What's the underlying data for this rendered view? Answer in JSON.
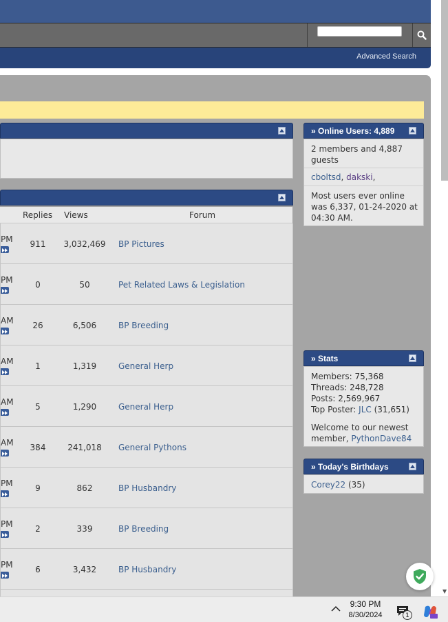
{
  "header": {
    "search": {
      "placeholder": "",
      "value": ""
    },
    "advanced_search_label": "Advanced Search"
  },
  "thread_table": {
    "columns": {
      "replies": "Replies",
      "views": "Views",
      "forum": "Forum"
    },
    "rows": [
      {
        "time_fragment": "PM",
        "replies": "911",
        "views": "3,032,469",
        "forum": "BP Pictures"
      },
      {
        "time_fragment": "PM",
        "replies": "0",
        "views": "50",
        "forum": "Pet Related Laws & Legislation"
      },
      {
        "time_fragment": "AM",
        "replies": "26",
        "views": "6,506",
        "forum": "BP Breeding"
      },
      {
        "time_fragment": "AM",
        "replies": "1",
        "views": "1,319",
        "forum": "General Herp"
      },
      {
        "time_fragment": "AM",
        "replies": "5",
        "views": "1,290",
        "forum": "General Herp"
      },
      {
        "time_fragment": "AM",
        "replies": "384",
        "views": "241,018",
        "forum": "General Pythons"
      },
      {
        "time_fragment": "PM",
        "replies": "9",
        "views": "862",
        "forum": "BP Husbandry"
      },
      {
        "time_fragment": "PM",
        "replies": "2",
        "views": "339",
        "forum": "BP Breeding"
      },
      {
        "time_fragment": "PM",
        "replies": "6",
        "views": "3,432",
        "forum": "BP Husbandry"
      }
    ]
  },
  "online_users": {
    "title": "» Online Users: 4,889",
    "summary": "2 members and 4,887 guests",
    "user1": "cboltsd",
    "sep1": ",",
    "user2": "dakski",
    "sep2": ",",
    "record": "Most users ever online was 6,337, 01-24-2020 at 04:30 AM."
  },
  "stats": {
    "title": "» Stats",
    "members": "Members: 75,368",
    "threads": "Threads: 248,728",
    "posts": "Posts: 2,569,967",
    "top_poster_label": "Top Poster:",
    "top_poster_name": "JLC",
    "top_poster_count": "(31,651)",
    "welcome_text": "Welcome to our newest member,",
    "newest_member": "PythonDave84"
  },
  "birthdays": {
    "title": "» Today's Birthdays",
    "name": "Corey22",
    "age": "(35)"
  },
  "taskbar": {
    "time": "9:30 PM",
    "date": "8/30/2024",
    "notification_count": "1"
  },
  "colors": {
    "header_blue": "#3d5a8f",
    "nav_blue": "#28447a",
    "section_head": "#2c4a84",
    "notice_yellow": "#fdeb98",
    "link": "#3b5f8e"
  },
  "icons": [
    "search-icon",
    "collapse-icon",
    "go-to-last-post-icon",
    "shield-check-icon",
    "chevron-up-icon",
    "notification-icon",
    "copilot-icon"
  ]
}
